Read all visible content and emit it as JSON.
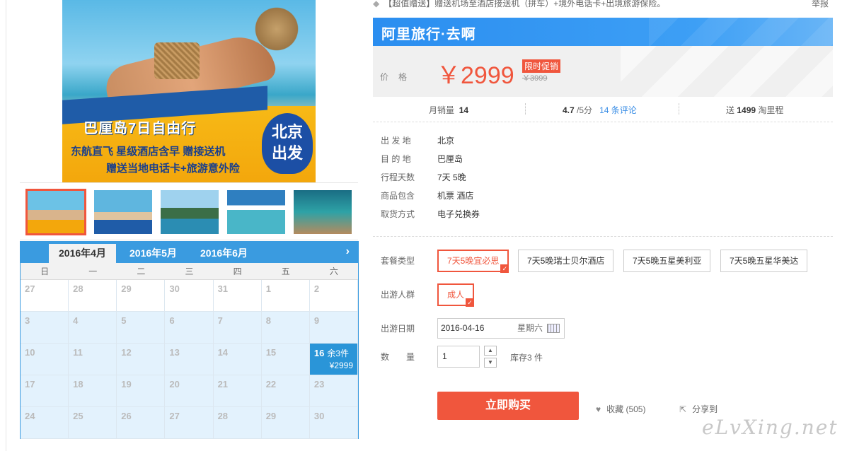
{
  "top_notice": "【超值赠送】赠送机场至酒店接送机（拼车）+境外电话卡+出境旅游保险。",
  "report_link": "举报",
  "gallery": {
    "main_banner": {
      "title": "巴厘岛7日自由行",
      "line1": "东航直飞  星级酒店含早  赠接送机",
      "line2": "赠送当地电话卡+旅游意外险",
      "badge_line1": "北京",
      "badge_line2": "出发"
    },
    "thumbnails": [
      "巴厘岛海滩",
      "巴厘岛海报",
      "海神庙",
      "泳池别墅",
      "海底珊瑚"
    ]
  },
  "calendar": {
    "tabs": [
      "2016年4月",
      "2016年5月",
      "2016年6月"
    ],
    "next_icon": "›",
    "weekdays": [
      "日",
      "一",
      "二",
      "三",
      "四",
      "五",
      "六"
    ],
    "days": [
      {
        "d": "27"
      },
      {
        "d": "28"
      },
      {
        "d": "29"
      },
      {
        "d": "30"
      },
      {
        "d": "31"
      },
      {
        "d": "1"
      },
      {
        "d": "2"
      },
      {
        "d": "3"
      },
      {
        "d": "4"
      },
      {
        "d": "5"
      },
      {
        "d": "6"
      },
      {
        "d": "7"
      },
      {
        "d": "8"
      },
      {
        "d": "9"
      },
      {
        "d": "10"
      },
      {
        "d": "11"
      },
      {
        "d": "12"
      },
      {
        "d": "13"
      },
      {
        "d": "14"
      },
      {
        "d": "15"
      },
      {
        "d": "16",
        "stock": "余3件",
        "price": "¥2999"
      },
      {
        "d": "17"
      },
      {
        "d": "18"
      },
      {
        "d": "19"
      },
      {
        "d": "20"
      },
      {
        "d": "21"
      },
      {
        "d": "22"
      },
      {
        "d": "23"
      },
      {
        "d": "24"
      },
      {
        "d": "25"
      },
      {
        "d": "26"
      },
      {
        "d": "27"
      },
      {
        "d": "28"
      },
      {
        "d": "29"
      },
      {
        "d": "30"
      }
    ]
  },
  "brand": {
    "title": "阿里旅行·去啊"
  },
  "price": {
    "label": "价格",
    "value": "￥2999",
    "promo_tag": "限时促销",
    "original": "￥3999"
  },
  "stats": {
    "monthly_sales_label": "月销量",
    "monthly_sales_value": "14",
    "rating_value": "4.7",
    "rating_suffix": "/5分",
    "reviews_link": "14 条评论",
    "points_prefix": "送",
    "points_value": "1499",
    "points_suffix": "淘里程"
  },
  "info": [
    {
      "label": "出 发 地",
      "value": "北京"
    },
    {
      "label": "目 的 地",
      "value": "巴厘岛"
    },
    {
      "label": "行程天数",
      "value": "7天 5晚"
    },
    {
      "label": "商品包含",
      "value": "机票  酒店"
    },
    {
      "label": "取货方式",
      "value": "电子兑换券"
    }
  ],
  "options": {
    "package_label": "套餐类型",
    "packages": [
      "7天5晚宜必思",
      "7天5晚瑞士贝尔酒店",
      "7天5晚五星美利亚",
      "7天5晚五星华美达"
    ],
    "traveler_label": "出游人群",
    "travelers": [
      "成人"
    ],
    "date_label": "出游日期",
    "date_value": "2016-04-16",
    "date_weekday": "星期六",
    "qty_label": "数　　量",
    "qty_value": "1",
    "stock_note": "库存3 件"
  },
  "actions": {
    "buy_label": "立即购买",
    "fav_label": "收藏 (505)",
    "share_label": "分享到"
  },
  "watermark": "eLvXing.net",
  "colors": {
    "accent": "#f0563d",
    "brand_blue": "#2b8ef0",
    "calendar_blue": "#3a9be0",
    "link_blue": "#3a8ee6"
  }
}
